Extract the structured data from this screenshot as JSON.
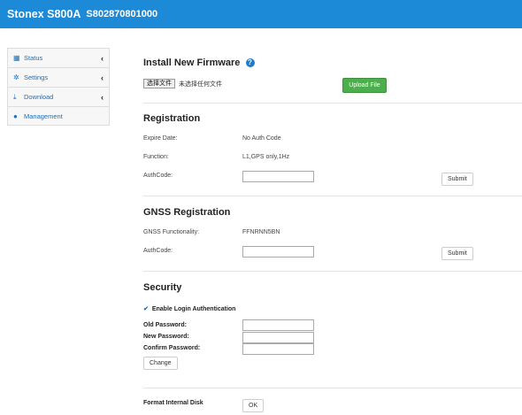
{
  "header": {
    "model": "Stonex S800A",
    "serial": "S802870801000"
  },
  "sidebar": {
    "items": [
      {
        "label": "Status",
        "icon": "grid-icon",
        "glyph": "▦",
        "chevron": "‹"
      },
      {
        "label": "Settings",
        "icon": "gear-icon",
        "glyph": "✲",
        "chevron": "‹"
      },
      {
        "label": "Download",
        "icon": "download-icon",
        "glyph": "⤓",
        "chevron": "‹"
      },
      {
        "label": "Management",
        "icon": "info-icon",
        "glyph": "●",
        "chevron": ""
      }
    ]
  },
  "firmware": {
    "title": "Install New Firmware",
    "help_glyph": "?",
    "choose_file_label": "选择文件",
    "file_status": "未选择任何文件",
    "upload_label": "Upload File"
  },
  "registration": {
    "title": "Registration",
    "expire_label": "Expire Date:",
    "expire_value": "No Auth Code",
    "function_label": "Function:",
    "function_value": "L1,GPS only,1Hz",
    "authcode_label": "AuthCode:",
    "authcode_value": "",
    "submit_label": "Submit"
  },
  "gnss": {
    "title": "GNSS Registration",
    "functionality_label": "GNSS Functionality:",
    "functionality_value": "FFNRNN5BN",
    "authcode_label": "AuthCode:",
    "authcode_value": "",
    "submit_label": "Submit"
  },
  "security": {
    "title": "Security",
    "enable_login_label": "Enable Login Authentication",
    "check_glyph": "✔",
    "old_password_label": "Old Password:",
    "new_password_label": "New Password:",
    "confirm_password_label": "Confirm Password:",
    "change_label": "Change"
  },
  "disk": {
    "format_label": "Format Internal Disk",
    "ok_label": "OK"
  }
}
